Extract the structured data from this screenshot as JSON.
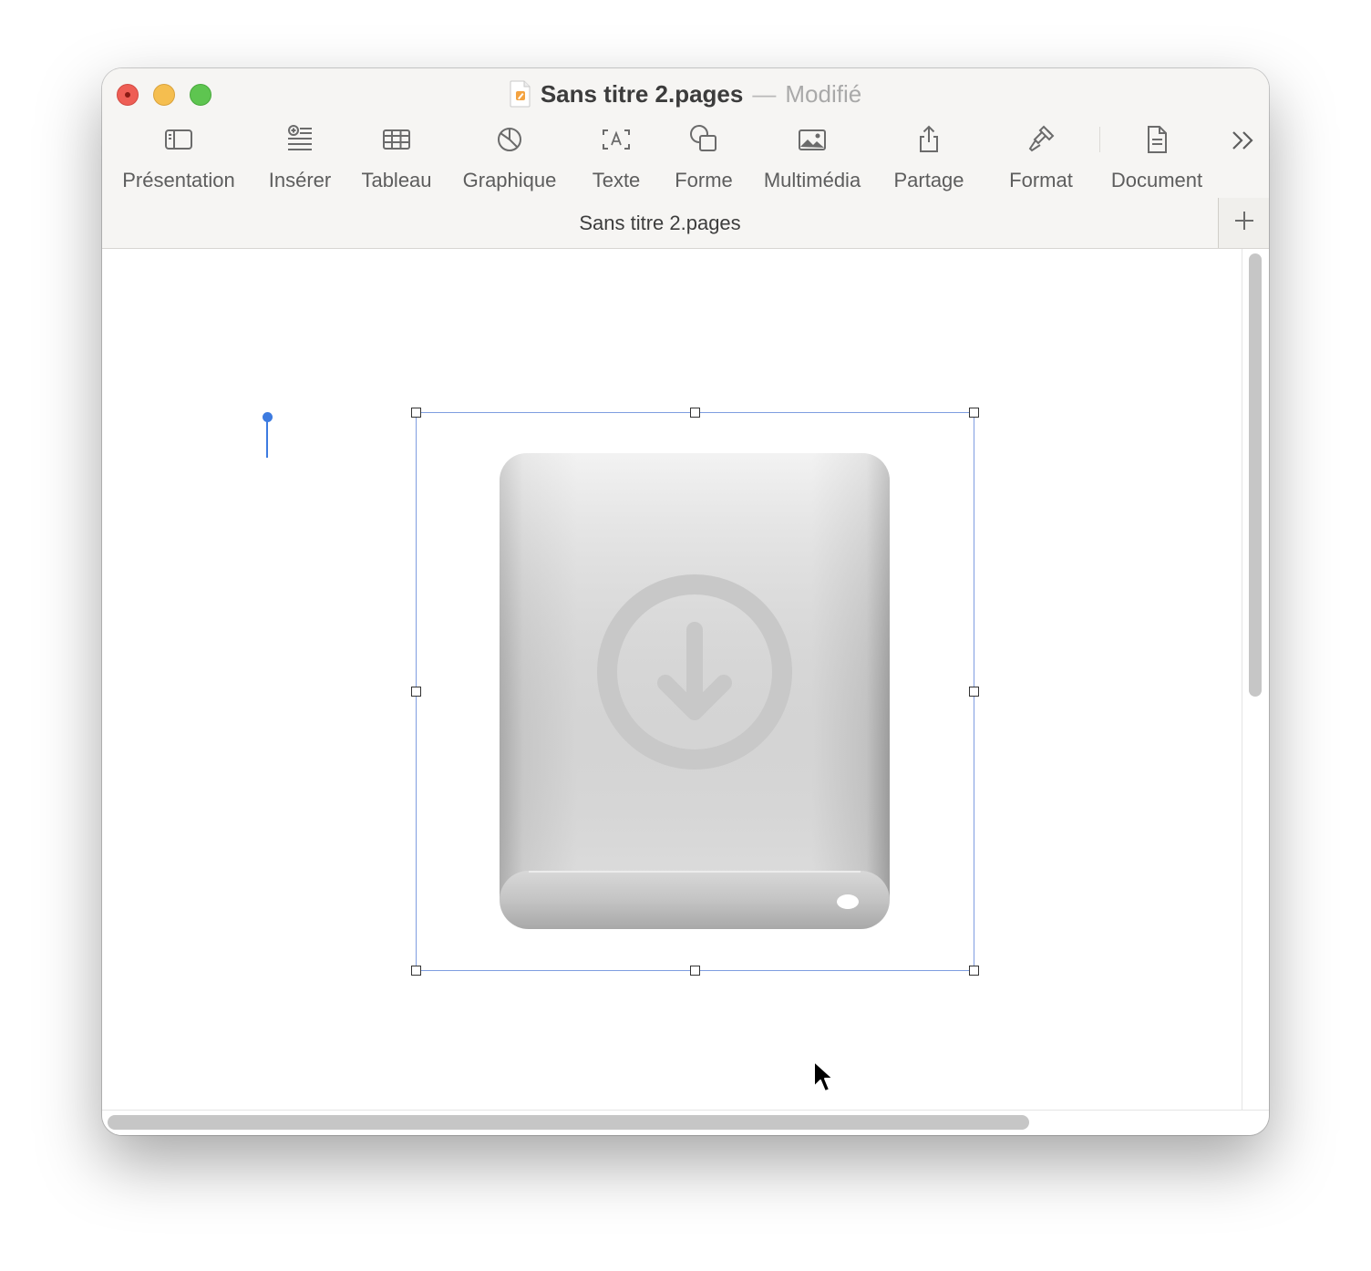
{
  "window": {
    "title": "Sans titre 2.pages",
    "title_separator": "—",
    "status": "Modifié"
  },
  "window_controls": [
    "close",
    "minimize",
    "zoom"
  ],
  "toolbar": {
    "items": [
      {
        "label": "Présentation",
        "icon": "sidebar-view-icon"
      },
      {
        "label": "Insérer",
        "icon": "insert-list-icon"
      },
      {
        "label": "Tableau",
        "icon": "table-icon"
      },
      {
        "label": "Graphique",
        "icon": "pie-chart-icon"
      },
      {
        "label": "Texte",
        "icon": "text-box-icon"
      },
      {
        "label": "Forme",
        "icon": "shape-icon"
      },
      {
        "label": "Multimédia",
        "icon": "photo-icon"
      },
      {
        "label": "Partage",
        "icon": "share-icon"
      },
      {
        "label": "Format",
        "icon": "paintbrush-icon"
      },
      {
        "label": "Document",
        "icon": "document-icon"
      }
    ],
    "overflow_icon": "chevron-double-right-icon"
  },
  "tab": {
    "label": "Sans titre 2.pages"
  },
  "new_tab_icon": "plus-icon",
  "document": {
    "selected_object": "external-drive-download-image"
  },
  "colors": {
    "accent": "#3d7be0",
    "selection_border": "#7f9de0",
    "close": "#ee5e55",
    "minimize": "#f5be4f",
    "zoom": "#5ec550",
    "toolbar_bg": "#f6f5f3"
  }
}
